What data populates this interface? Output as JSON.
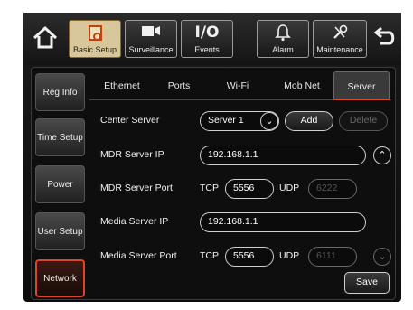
{
  "toolbar": {
    "tabs": [
      {
        "label": "Basic Setup",
        "icon": "basic-setup-icon"
      },
      {
        "label": "Surveillance",
        "icon": "camera-icon"
      },
      {
        "label": "Events",
        "icon_text": "I/O"
      },
      {
        "label": "Alarm",
        "icon": "bell-icon"
      },
      {
        "label": "Maintenance",
        "icon": "tools-icon"
      }
    ],
    "active_tab": "Basic Setup"
  },
  "sidebar": {
    "items": [
      {
        "label": "Reg Info"
      },
      {
        "label": "Time Setup"
      },
      {
        "label": "Power"
      },
      {
        "label": "User Setup"
      },
      {
        "label": "Network"
      }
    ],
    "active": "Network"
  },
  "subtabs": {
    "items": [
      "Ethernet",
      "Ports",
      "Wi-Fi",
      "Mob Net",
      "Server"
    ],
    "active": "Server"
  },
  "form": {
    "center_server_label": "Center Server",
    "center_server_value": "Server 1",
    "add_label": "Add",
    "delete_label": "Delete",
    "mdr_ip_label": "MDR Server IP",
    "mdr_ip_value": "192.168.1.1",
    "mdr_port_label": "MDR Server Port",
    "mdr_tcp_label": "TCP",
    "mdr_tcp_value": "5556",
    "mdr_udp_label": "UDP",
    "mdr_udp_value": "6222",
    "media_ip_label": "Media Server IP",
    "media_ip_value": "192.168.1.1",
    "media_port_label": "Media Server Port",
    "media_tcp_label": "TCP",
    "media_tcp_value": "5556",
    "media_udp_label": "UDP",
    "media_udp_value": "6111",
    "save_label": "Save"
  },
  "colors": {
    "accent": "#d9462a",
    "active_tab_bg": "#d8c79a"
  }
}
